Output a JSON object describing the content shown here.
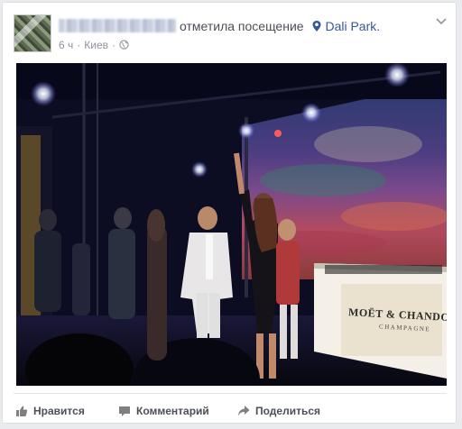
{
  "post": {
    "author_name": "",
    "verb": "отметила посещение",
    "place": "Dali Park.",
    "time": "6 ч",
    "location": "Киев"
  },
  "photo": {
    "sign_brand": "MOËT & CHANDON",
    "sign_sub": "CHAMPAGNE"
  },
  "actions": {
    "like": "Нравится",
    "comment": "Комментарий",
    "share": "Поделиться"
  },
  "colors": {
    "link": "#365899",
    "meta": "#90949c",
    "action": "#4b4f56"
  },
  "icons": [
    "location-pin-icon",
    "globe-icon",
    "chevron-down-icon",
    "like-icon",
    "comment-icon",
    "share-icon"
  ]
}
